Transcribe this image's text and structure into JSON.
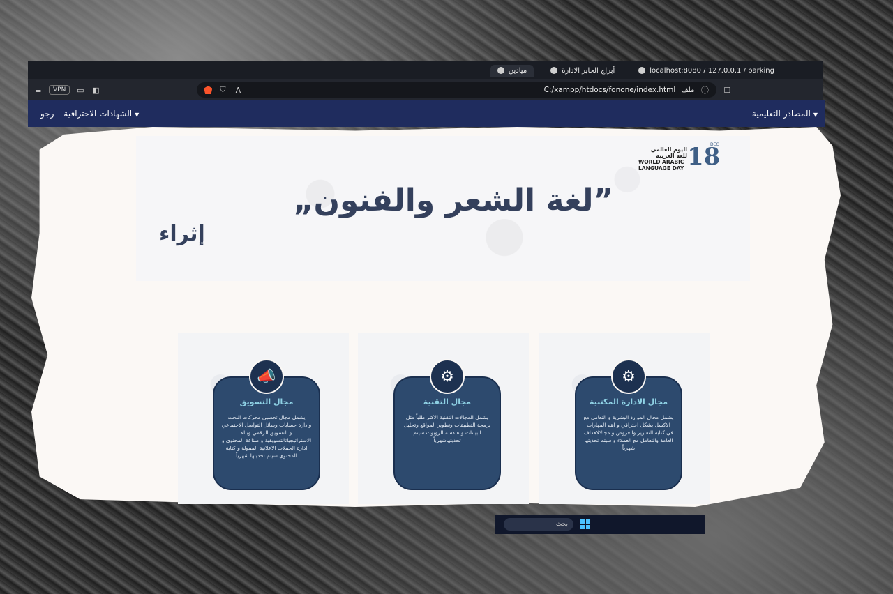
{
  "browser": {
    "tabs": [
      {
        "label": "localhost:8080 / 127.0.0.1 / parking",
        "active": false
      },
      {
        "label": "أبراج الخابر الادارة",
        "active": false
      },
      {
        "label": "ميادين",
        "active": true
      }
    ],
    "toolbar": {
      "vpn_label": "VPN",
      "file_label": "ملف",
      "url": "C:/xampp/htdocs/fonone/index.html"
    }
  },
  "site_nav": {
    "right_item": "المصادر التعليمية",
    "left_items": [
      "الشهادات الاحترافية",
      "رجو"
    ]
  },
  "hero": {
    "title": "”لغة الشعر والفنون„",
    "logo_number": "18",
    "logo_month": "DEC",
    "logo_ar_line1": "اليوم العالمي",
    "logo_ar_line2": "للغة العربية",
    "logo_en_line1": "WORLD ARABIC",
    "logo_en_line2": "LANGUAGE DAY",
    "side_mark": "إثراء"
  },
  "cards": [
    {
      "icon": "admin-icon",
      "title": "مجال الادارة المكتبية",
      "text": "يشمل مجال الموارد البشرية و التعامل مع الاكسل بشكل احترافي و اهم المهارات في كتابة التقارير والعروض و مجالالاهداف العامة والتعامل مع العملاء و سيتم تحديثها شهرياً"
    },
    {
      "icon": "tech-brain-icon",
      "title": "مجال التقنية",
      "text": "يشمل المجالات التقنية الاكثر طلباً مثل برمجة التطبيقات وتطوير المواقع وتحليل البيانات و هندسة الروبوت سيتم تحديثهاشهرياً"
    },
    {
      "icon": "marketing-megaphone-icon",
      "title": "مجال التسويق",
      "text": "يشمل مجال تحسين محركات البحث وادارة حسابات وسائل التواصل الاجتماعي و التسويق الرقمي وبناء الاستراتيجياتالتسويقية و صناعة المحتوى و ادارة الحملات الاعلانية الممولة و كتابة المحتوى سيتم تحديثها شهرياً"
    }
  ],
  "taskbar": {
    "search_label": "بحث"
  }
}
